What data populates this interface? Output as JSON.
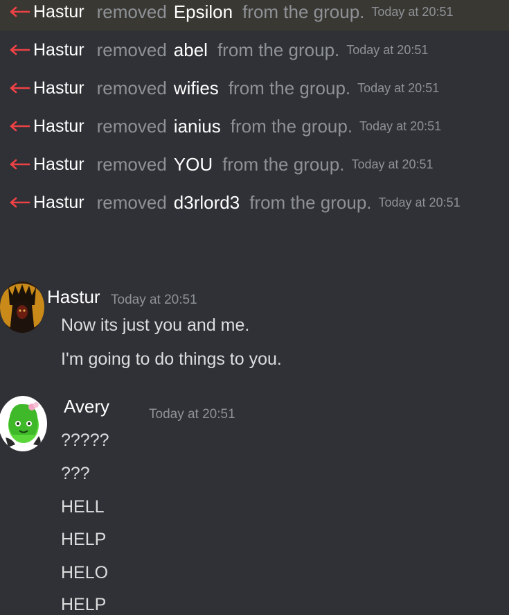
{
  "system_messages": [
    {
      "actor": "Hastur",
      "verb": "removed",
      "target": "Epsilon",
      "rest": "from the group.",
      "timestamp": "Today at 20:51"
    },
    {
      "actor": "Hastur",
      "verb": "removed",
      "target": "abel",
      "rest": "from the group.",
      "timestamp": "Today at 20:51"
    },
    {
      "actor": "Hastur",
      "verb": "removed",
      "target": "wifies",
      "rest": "from the group.",
      "timestamp": "Today at 20:51"
    },
    {
      "actor": "Hastur",
      "verb": "removed",
      "target": "ianius",
      "rest": "from the group.",
      "timestamp": "Today at 20:51"
    },
    {
      "actor": "Hastur",
      "verb": "removed",
      "target": "YOU",
      "rest": "from the group.",
      "timestamp": "Today at 20:51"
    },
    {
      "actor": "Hastur",
      "verb": "removed",
      "target": "d3rlord3",
      "rest": "from the group.",
      "timestamp": "Today at 20:51"
    }
  ],
  "messages": [
    {
      "username": "Hastur",
      "timestamp": "Today at 20:51",
      "lines": [
        "Now its just you and me.",
        "I'm going to do things to you."
      ]
    },
    {
      "username": "Avery",
      "timestamp": "Today at 20:51",
      "lines": [
        "?????",
        "???",
        "HELL",
        "HELP",
        "HELO",
        "HELP"
      ]
    }
  ],
  "colors": {
    "background": "#2f3136",
    "remove_arrow": "#ed4245",
    "text": "#dcddde",
    "muted": "#8e9297"
  },
  "icons": {
    "remove": "arrow-left-icon"
  }
}
